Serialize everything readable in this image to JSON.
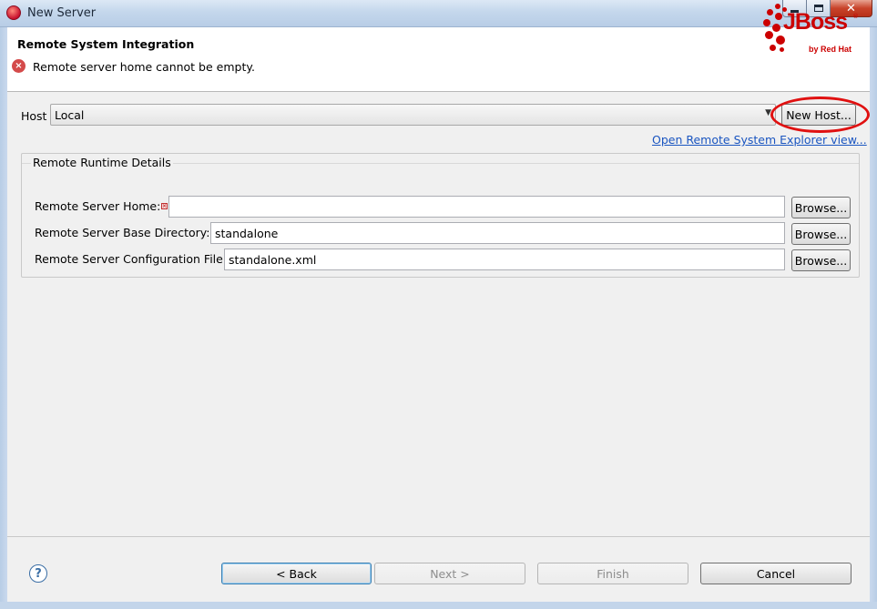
{
  "window": {
    "title": "New Server"
  },
  "banner": {
    "title": "Remote System Integration",
    "message": "Remote server home cannot be empty.",
    "logo_text": "JBoss",
    "logo_reg": "®",
    "logo_sub": "by Red Hat"
  },
  "host": {
    "label": "Host",
    "value": "Local",
    "new_host_button": "New Host...",
    "explorer_link": "Open Remote System Explorer view..."
  },
  "group": {
    "legend": "Remote Runtime Details",
    "rows": [
      {
        "label": "Remote Server Home:",
        "value": "",
        "browse": "Browse..."
      },
      {
        "label": "Remote Server Base Directory:",
        "value": "standalone",
        "browse": "Browse..."
      },
      {
        "label": "Remote Server Configuration File:",
        "value": "standalone.xml",
        "browse": "Browse..."
      }
    ]
  },
  "footer": {
    "back": "< Back",
    "next": "Next >",
    "finish": "Finish",
    "cancel": "Cancel"
  },
  "icons": {
    "help": "?",
    "error": "×",
    "dropdown": "▼",
    "close": "✕"
  },
  "colors": {
    "accent_red": "#cc0000",
    "link_blue": "#1a55c0",
    "annotation_red": "#e01010"
  }
}
